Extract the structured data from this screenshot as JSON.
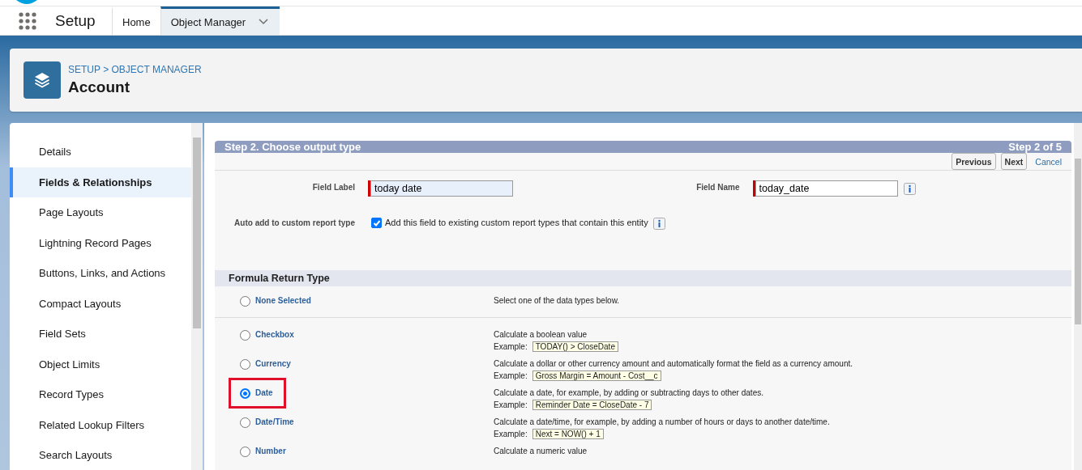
{
  "nav": {
    "app_title": "Setup",
    "tabs": [
      {
        "label": "Home",
        "selected": false,
        "dropdown": false
      },
      {
        "label": "Object Manager",
        "selected": true,
        "dropdown": true
      }
    ]
  },
  "header": {
    "breadcrumb": "SETUP > OBJECT MANAGER",
    "title": "Account"
  },
  "sidebar": {
    "items": [
      {
        "label": "Details",
        "selected": false
      },
      {
        "label": "Fields & Relationships",
        "selected": true
      },
      {
        "label": "Page Layouts",
        "selected": false
      },
      {
        "label": "Lightning Record Pages",
        "selected": false
      },
      {
        "label": "Buttons, Links, and Actions",
        "selected": false
      },
      {
        "label": "Compact Layouts",
        "selected": false
      },
      {
        "label": "Field Sets",
        "selected": false
      },
      {
        "label": "Object Limits",
        "selected": false
      },
      {
        "label": "Record Types",
        "selected": false
      },
      {
        "label": "Related Lookup Filters",
        "selected": false
      },
      {
        "label": "Search Layouts",
        "selected": false
      }
    ]
  },
  "wizard": {
    "title": "Step 2. Choose output type",
    "step": "Step 2 of 5",
    "buttons": [
      "Previous",
      "Next"
    ],
    "cancel": "Cancel",
    "field_label": {
      "label": "Field Label",
      "value": "today date"
    },
    "field_name": {
      "label": "Field Name",
      "value": "today_date"
    },
    "auto_add": {
      "label": "Auto add to custom report type",
      "checked": true,
      "text": "Add this field to existing custom report types that contain this entity"
    },
    "section_title": "Formula Return Type",
    "options": [
      {
        "label": "None Selected",
        "selected": false,
        "highlighted": false,
        "description": "Select one of the data types below."
      },
      {
        "label": "Checkbox",
        "selected": false,
        "highlighted": false,
        "description": "Calculate a boolean value",
        "example_label": "Example:",
        "example": "TODAY() > CloseDate"
      },
      {
        "label": "Currency",
        "selected": false,
        "highlighted": false,
        "description": "Calculate a dollar or other currency amount and automatically format the field as a currency amount.",
        "example_label": "Example:",
        "example": "Gross Margin = Amount - Cost__c"
      },
      {
        "label": "Date",
        "selected": true,
        "highlighted": true,
        "description": "Calculate a date, for example, by adding or subtracting days to other dates.",
        "example_label": "Example:",
        "example": "Reminder Date = CloseDate - 7"
      },
      {
        "label": "Date/Time",
        "selected": false,
        "highlighted": false,
        "description": "Calculate a date/time, for example, by adding a number of hours or days to another date/time.",
        "example_label": "Example:",
        "example": "Next = NOW() + 1"
      },
      {
        "label": "Number",
        "selected": false,
        "highlighted": false,
        "description": "Calculate a numeric value"
      }
    ]
  }
}
